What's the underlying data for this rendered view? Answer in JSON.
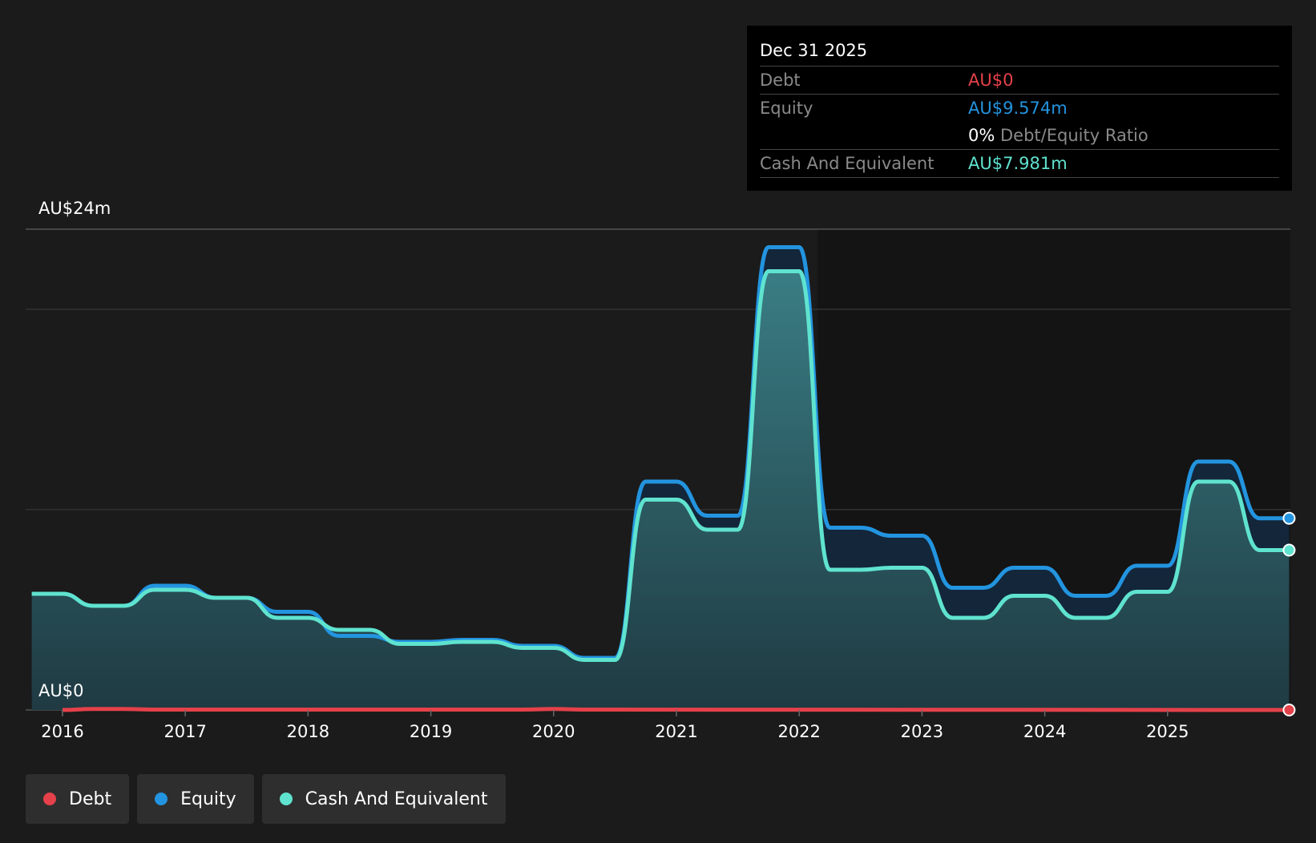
{
  "tooltip": {
    "date": "Dec 31 2025",
    "debt_label": "Debt",
    "debt_value": "AU$0",
    "equity_label": "Equity",
    "equity_value": "AU$9.574m",
    "ratio_value": "0%",
    "ratio_label": "Debt/Equity Ratio",
    "cash_label": "Cash And Equivalent",
    "cash_value": "AU$7.981m"
  },
  "legend": [
    {
      "label": "Debt",
      "color": "#e5414a"
    },
    {
      "label": "Equity",
      "color": "#2394df"
    },
    {
      "label": "Cash And Equivalent",
      "color": "#5fe3cf"
    }
  ],
  "chart_data": {
    "type": "area",
    "y_top_label": "AU$24m",
    "y_bottom_label": "AU$0",
    "ylim": [
      0,
      24
    ],
    "xlim": [
      2015.7,
      2026.0
    ],
    "x_ticks": [
      "2016",
      "2017",
      "2018",
      "2019",
      "2020",
      "2021",
      "2022",
      "2023",
      "2024",
      "2025"
    ],
    "x_tick_values": [
      2016,
      2017,
      2018,
      2019,
      2020,
      2021,
      2022,
      2023,
      2024,
      2025
    ],
    "gridlines": [
      10,
      20,
      24
    ],
    "series": [
      {
        "name": "Equity",
        "color": "#2394df",
        "points": [
          [
            2015.75,
            5.8
          ],
          [
            2016.0,
            5.8
          ],
          [
            2016.25,
            5.2
          ],
          [
            2016.5,
            5.2
          ],
          [
            2016.75,
            6.2
          ],
          [
            2017.0,
            6.2
          ],
          [
            2017.25,
            5.6
          ],
          [
            2017.5,
            5.6
          ],
          [
            2017.75,
            4.9
          ],
          [
            2018.0,
            4.9
          ],
          [
            2018.25,
            3.7
          ],
          [
            2018.5,
            3.7
          ],
          [
            2018.75,
            3.4
          ],
          [
            2019.0,
            3.4
          ],
          [
            2019.25,
            3.5
          ],
          [
            2019.5,
            3.5
          ],
          [
            2019.75,
            3.2
          ],
          [
            2020.0,
            3.2
          ],
          [
            2020.25,
            2.6
          ],
          [
            2020.5,
            2.6
          ],
          [
            2020.75,
            11.4
          ],
          [
            2021.0,
            11.4
          ],
          [
            2021.25,
            9.7
          ],
          [
            2021.5,
            9.7
          ],
          [
            2021.75,
            23.1
          ],
          [
            2022.0,
            23.1
          ],
          [
            2022.25,
            9.1
          ],
          [
            2022.5,
            9.1
          ],
          [
            2022.75,
            8.7
          ],
          [
            2023.0,
            8.7
          ],
          [
            2023.25,
            6.1
          ],
          [
            2023.5,
            6.1
          ],
          [
            2023.75,
            7.1
          ],
          [
            2024.0,
            7.1
          ],
          [
            2024.25,
            5.7
          ],
          [
            2024.5,
            5.7
          ],
          [
            2024.75,
            7.2
          ],
          [
            2025.0,
            7.2
          ],
          [
            2025.25,
            12.4
          ],
          [
            2025.5,
            12.4
          ],
          [
            2025.75,
            9.57
          ],
          [
            2025.99,
            9.57
          ]
        ]
      },
      {
        "name": "Cash And Equivalent",
        "color": "#5fe3cf",
        "points": [
          [
            2015.75,
            5.8
          ],
          [
            2016.0,
            5.8
          ],
          [
            2016.25,
            5.2
          ],
          [
            2016.5,
            5.2
          ],
          [
            2016.75,
            6.0
          ],
          [
            2017.0,
            6.0
          ],
          [
            2017.25,
            5.6
          ],
          [
            2017.5,
            5.6
          ],
          [
            2017.75,
            4.6
          ],
          [
            2018.0,
            4.6
          ],
          [
            2018.25,
            4.0
          ],
          [
            2018.5,
            4.0
          ],
          [
            2018.75,
            3.3
          ],
          [
            2019.0,
            3.3
          ],
          [
            2019.25,
            3.4
          ],
          [
            2019.5,
            3.4
          ],
          [
            2019.75,
            3.1
          ],
          [
            2020.0,
            3.1
          ],
          [
            2020.25,
            2.5
          ],
          [
            2020.5,
            2.5
          ],
          [
            2020.75,
            10.5
          ],
          [
            2021.0,
            10.5
          ],
          [
            2021.25,
            9.0
          ],
          [
            2021.5,
            9.0
          ],
          [
            2021.75,
            21.9
          ],
          [
            2022.0,
            21.9
          ],
          [
            2022.25,
            7.0
          ],
          [
            2022.5,
            7.0
          ],
          [
            2022.75,
            7.1
          ],
          [
            2023.0,
            7.1
          ],
          [
            2023.25,
            4.6
          ],
          [
            2023.5,
            4.6
          ],
          [
            2023.75,
            5.7
          ],
          [
            2024.0,
            5.7
          ],
          [
            2024.25,
            4.6
          ],
          [
            2024.5,
            4.6
          ],
          [
            2024.75,
            5.9
          ],
          [
            2025.0,
            5.9
          ],
          [
            2025.25,
            11.4
          ],
          [
            2025.5,
            11.4
          ],
          [
            2025.75,
            7.98
          ],
          [
            2025.99,
            7.98
          ]
        ]
      },
      {
        "name": "Debt",
        "color": "#e5414a",
        "points": [
          [
            2016.0,
            0.0
          ],
          [
            2016.25,
            0.05
          ],
          [
            2016.5,
            0.05
          ],
          [
            2016.75,
            0.02
          ],
          [
            2019.75,
            0.02
          ],
          [
            2020.0,
            0.05
          ],
          [
            2020.25,
            0.02
          ],
          [
            2025.99,
            0.0
          ]
        ]
      }
    ]
  }
}
